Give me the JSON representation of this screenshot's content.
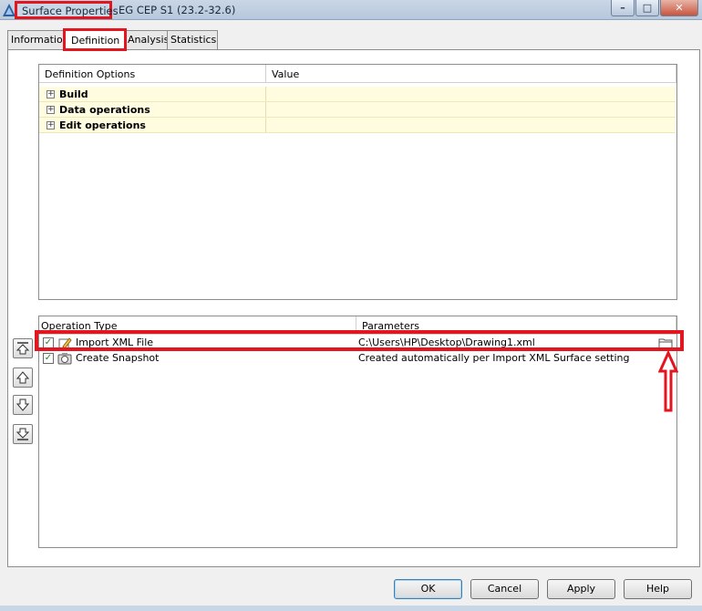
{
  "window": {
    "title": "Surface Properties",
    "subtitle": "EG CEP S1 (23.2-32.6)",
    "controls": {
      "minimize": "–",
      "maximize": "□",
      "close": "✕"
    }
  },
  "tabs": [
    {
      "label": "Information",
      "active": false
    },
    {
      "label": "Definition",
      "active": true
    },
    {
      "label": "Analysis",
      "active": false
    },
    {
      "label": "Statistics",
      "active": false
    }
  ],
  "definition_options": {
    "columns": [
      "Definition Options",
      "Value"
    ],
    "rows": [
      {
        "label": "Build",
        "value": ""
      },
      {
        "label": "Data operations",
        "value": ""
      },
      {
        "label": "Edit operations",
        "value": ""
      }
    ]
  },
  "operations": {
    "columns": [
      "Operation Type",
      "Parameters"
    ],
    "rows": [
      {
        "checked": true,
        "icon": "import-xml-icon",
        "type": "Import XML File",
        "parameters": "C:\\Users\\HP\\Desktop\\Drawing1.xml"
      },
      {
        "checked": true,
        "icon": "snapshot-icon",
        "type": "Create Snapshot",
        "parameters": "Created automatically per Import XML Surface setting"
      }
    ]
  },
  "side_buttons": [
    "move-to-top-icon",
    "move-up-icon",
    "move-down-icon",
    "move-to-bottom-icon"
  ],
  "buttons": {
    "ok": "OK",
    "cancel": "Cancel",
    "apply": "Apply",
    "help": "Help"
  },
  "colors": {
    "highlight": "#e3161f",
    "row_tint": "#fffce0",
    "check": "#1b8a1b"
  }
}
